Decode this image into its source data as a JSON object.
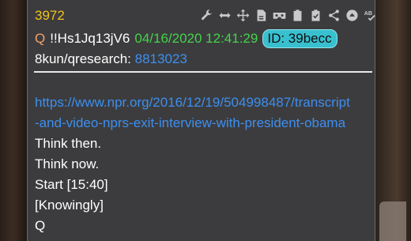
{
  "post": {
    "number": "3972",
    "author": "Q",
    "tripcode": "!!Hs1Jq13jV6",
    "date": "04/16/2020 12:41:29",
    "id_badge": "ID: 39becc",
    "board": "8kun/qresearch:",
    "board_ref": "8813023",
    "link_line1": "https://www.npr.org/2016/12/19/504998487/transcript",
    "link_line2": "-and-video-nprs-exit-interview-with-president-obama",
    "lines": [
      "Think then.",
      "Think now.",
      "Start [15:40]",
      "[Knowingly]",
      "Q"
    ]
  },
  "toolbar": {
    "icons": [
      "wrench-icon",
      "resize-horizontal-icon",
      "move-icon",
      "document-icon",
      "vr-glasses-icon",
      "clipboard-icon",
      "clipboard-check-icon",
      "share-icon",
      "up-arrow-circle-icon",
      "spellcheck-icon"
    ],
    "spellcheck_label": "AB"
  },
  "colors": {
    "post_number": "#f2c21b",
    "author": "#f0a36a",
    "date": "#44d44a",
    "id_badge": "#39c0cf",
    "link": "#3d8ff0",
    "card": "#3c3c3e"
  }
}
